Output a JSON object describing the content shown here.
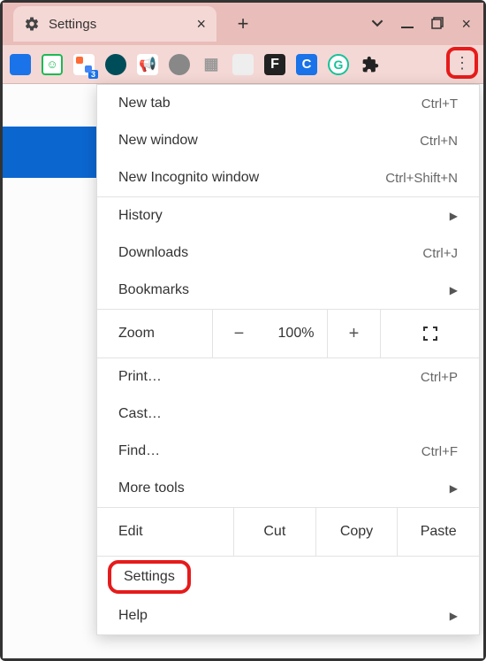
{
  "tab": {
    "title": "Settings"
  },
  "extensions": {
    "badge": "3"
  },
  "menu": {
    "new_tab": {
      "label": "New tab",
      "shortcut": "Ctrl+T"
    },
    "new_window": {
      "label": "New window",
      "shortcut": "Ctrl+N"
    },
    "new_incognito": {
      "label": "New Incognito window",
      "shortcut": "Ctrl+Shift+N"
    },
    "history": {
      "label": "History"
    },
    "downloads": {
      "label": "Downloads",
      "shortcut": "Ctrl+J"
    },
    "bookmarks": {
      "label": "Bookmarks"
    },
    "zoom": {
      "label": "Zoom",
      "value": "100%"
    },
    "print": {
      "label": "Print…",
      "shortcut": "Ctrl+P"
    },
    "cast": {
      "label": "Cast…"
    },
    "find": {
      "label": "Find…",
      "shortcut": "Ctrl+F"
    },
    "more_tools": {
      "label": "More tools"
    },
    "edit": {
      "label": "Edit",
      "cut": "Cut",
      "copy": "Copy",
      "paste": "Paste"
    },
    "settings": {
      "label": "Settings"
    },
    "help": {
      "label": "Help"
    }
  }
}
